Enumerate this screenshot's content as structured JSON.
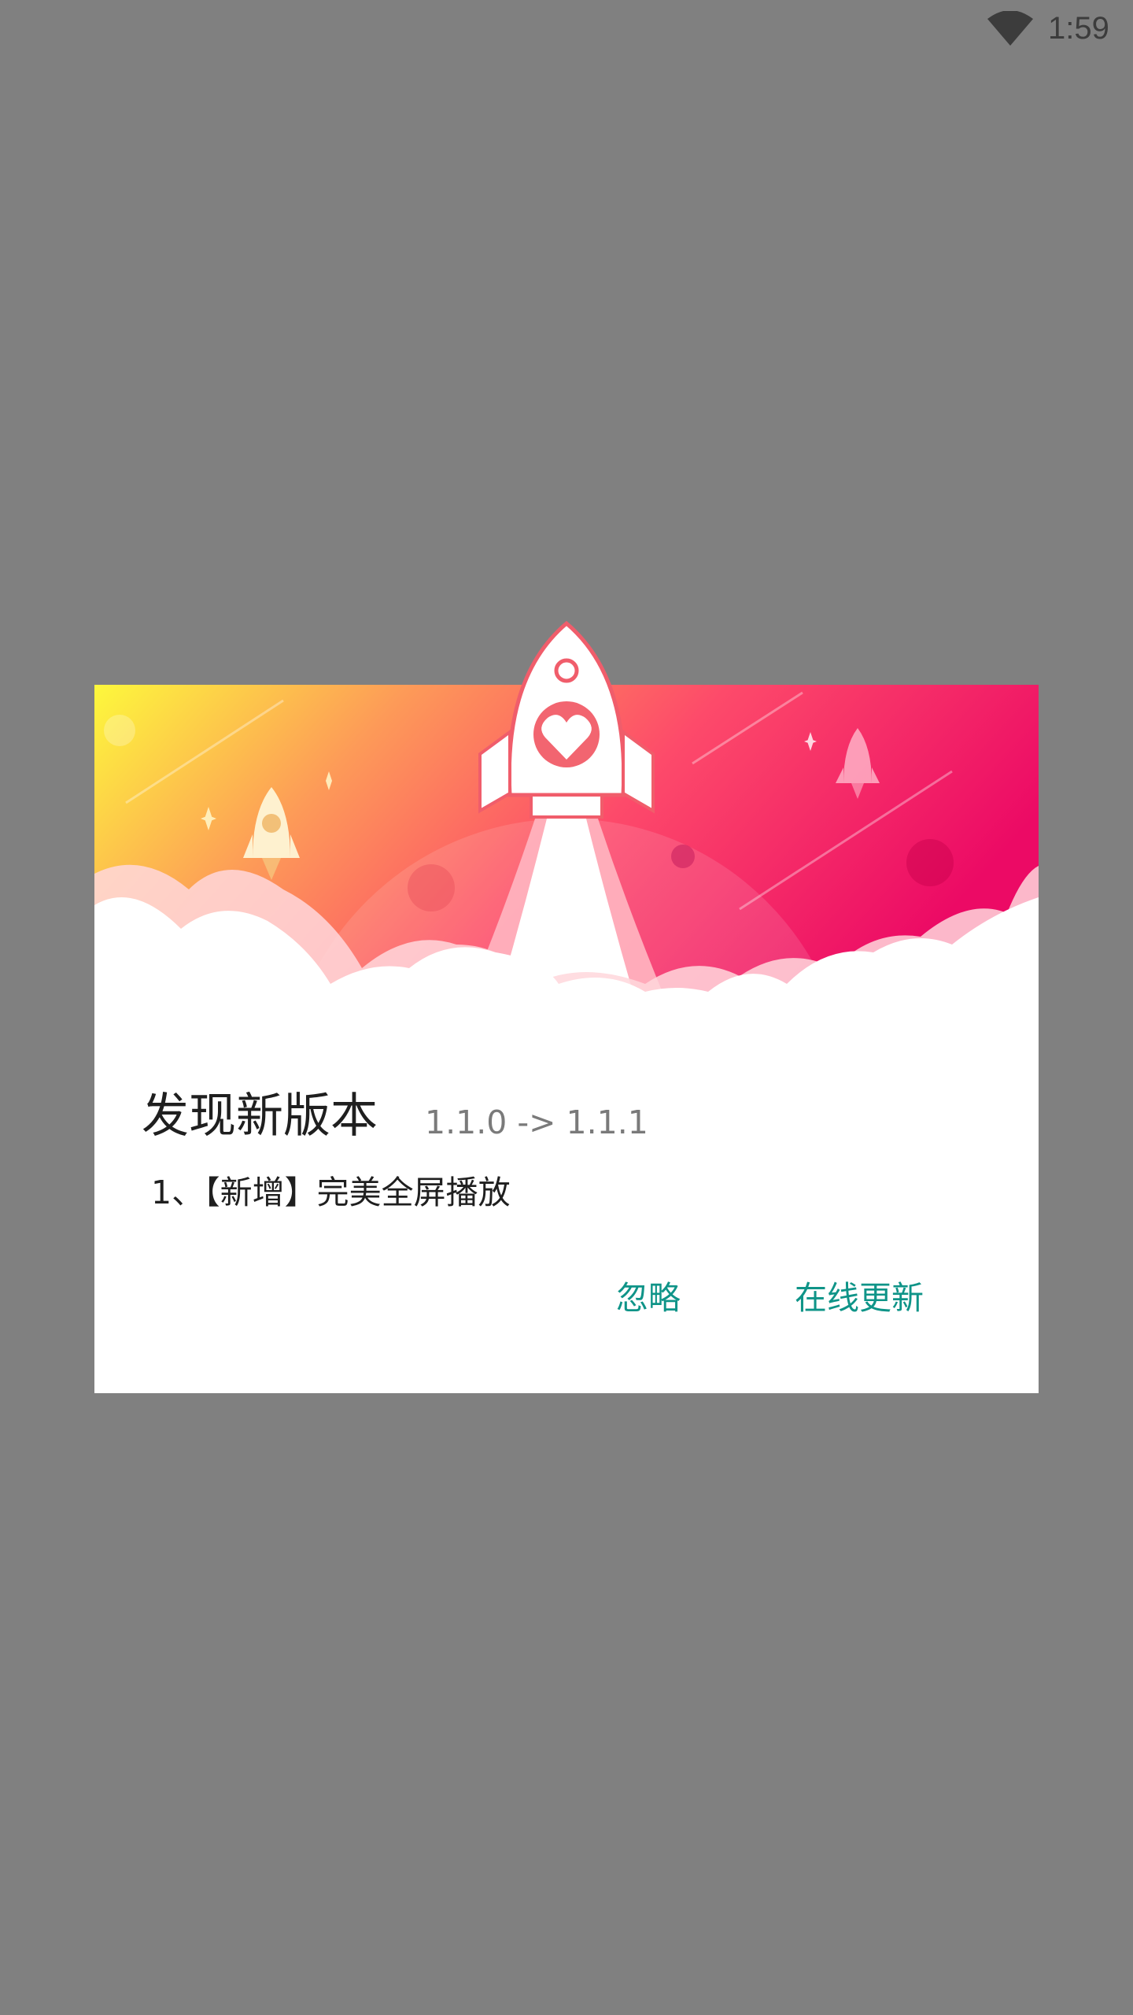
{
  "status_bar": {
    "time": "1:59",
    "wifi_icon": "wifi-icon"
  },
  "dialog": {
    "title": "发现新版本",
    "version": "1.1.0 -> 1.1.1",
    "changelog": [
      "1、【新增】完美全屏播放"
    ],
    "buttons": {
      "ignore": "忽略",
      "update": "在线更新"
    },
    "banner_icon": "rocket-heart-icon"
  },
  "colors": {
    "overlay": "#808080",
    "accent": "#0f9488",
    "gradient_start": "#fdf83c",
    "gradient_end": "#ec0a65"
  }
}
